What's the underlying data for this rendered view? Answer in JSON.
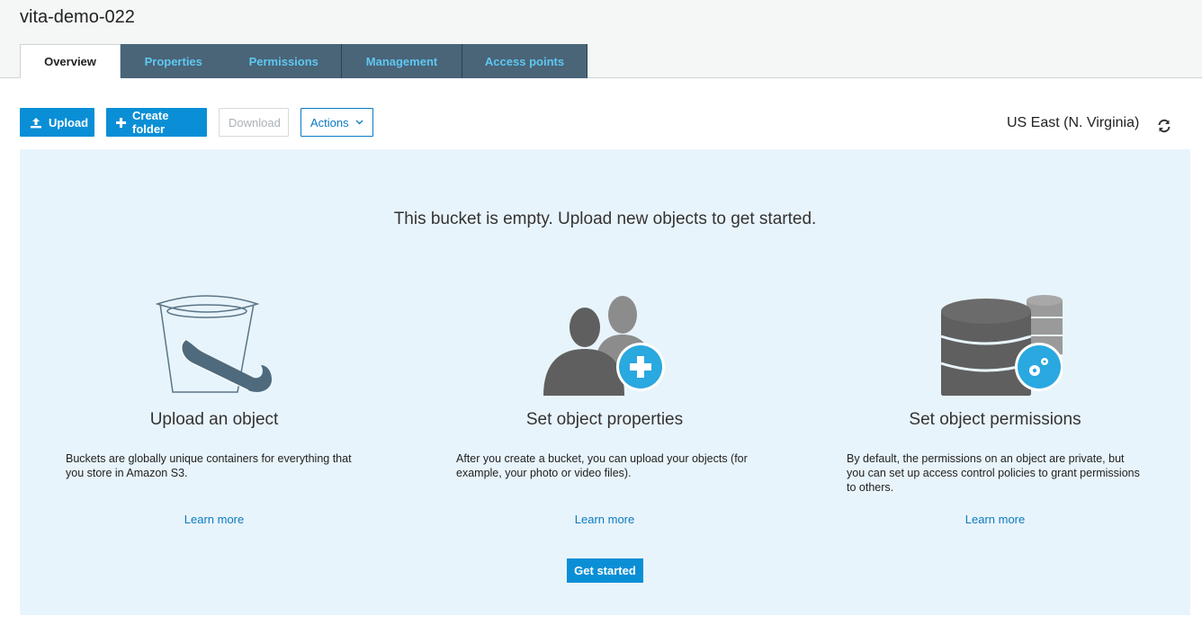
{
  "bucket": {
    "name": "vita-demo-022"
  },
  "tabs": [
    {
      "label": "Overview"
    },
    {
      "label": "Properties"
    },
    {
      "label": "Permissions"
    },
    {
      "label": "Management"
    },
    {
      "label": "Access points"
    }
  ],
  "toolbar": {
    "upload_label": "Upload",
    "create_folder_label": "Create folder",
    "download_label": "Download",
    "actions_label": "Actions",
    "region": "US East (N. Virginia)"
  },
  "empty_state": {
    "message": "This bucket is empty. Upload new objects to get started.",
    "cards": [
      {
        "title": "Upload an object",
        "text": "Buckets are globally unique containers for everything that you store in Amazon S3.",
        "link": "Learn more"
      },
      {
        "title": "Set object properties",
        "text": "After you create a bucket, you can upload your objects (for example, your photo or video files).",
        "link": "Learn more"
      },
      {
        "title": "Set object permissions",
        "text": "By default, the permissions on an object are private, but you can set up access control policies to grant permissions to others.",
        "link": "Learn more"
      }
    ],
    "cta_label": "Get started"
  },
  "colors": {
    "primary": "#0a8fd6",
    "tab_dark": "#4a6478",
    "tab_text": "#5ec8f0",
    "panel_bg": "#e8f4fb"
  },
  "icons": [
    "upload-icon",
    "plus-icon",
    "chevron-down-icon",
    "refresh-icon"
  ]
}
